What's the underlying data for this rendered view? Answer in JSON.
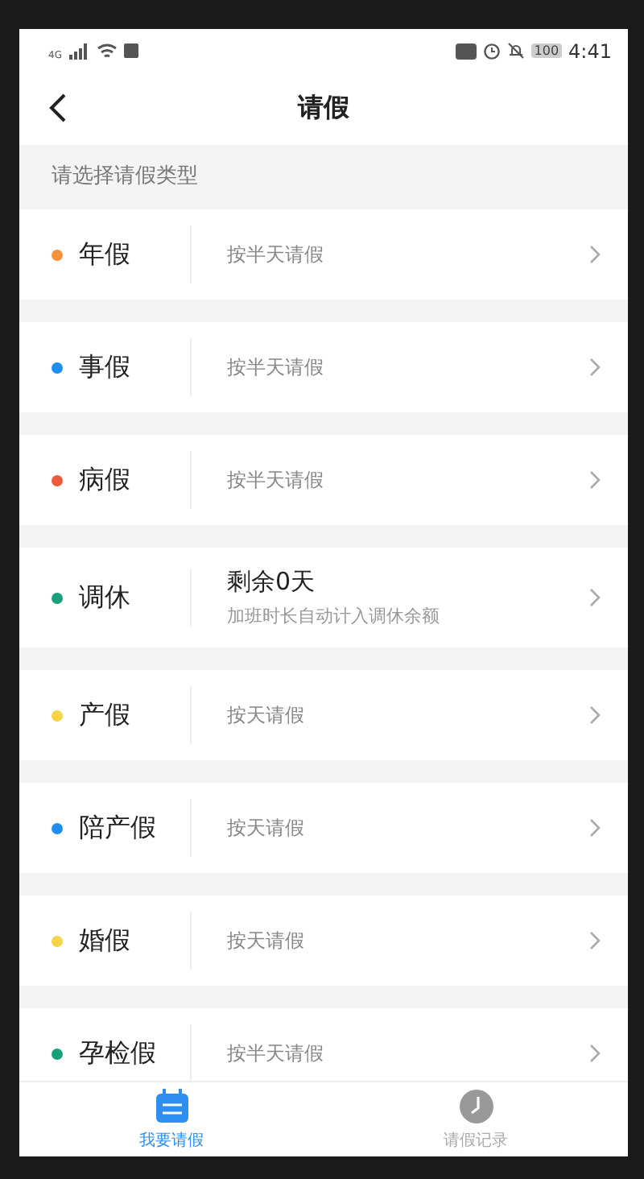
{
  "status_bar": {
    "network": "4G",
    "time": "4:41",
    "battery": "100"
  },
  "nav": {
    "title": "请假"
  },
  "section_header": "请选择请假类型",
  "leave_types": [
    {
      "name": "年假",
      "color": "#f5933a",
      "kind": "simple",
      "note": "按半天请假"
    },
    {
      "name": "事假",
      "color": "#1e8ff0",
      "kind": "simple",
      "note": "按半天请假"
    },
    {
      "name": "病假",
      "color": "#f05a3c",
      "kind": "simple",
      "note": "按半天请假"
    },
    {
      "name": "调休",
      "color": "#17a07a",
      "kind": "balance",
      "balance": "剩余0天",
      "note": "加班时长自动计入调休余额"
    },
    {
      "name": "产假",
      "color": "#f7d348",
      "kind": "simple",
      "note": "按天请假"
    },
    {
      "name": "陪产假",
      "color": "#1e8ff0",
      "kind": "simple",
      "note": "按天请假"
    },
    {
      "name": "婚假",
      "color": "#f7d348",
      "kind": "simple",
      "note": "按天请假"
    },
    {
      "name": "孕检假",
      "color": "#17a07a",
      "kind": "simple",
      "note": "按半天请假"
    }
  ],
  "tabs": [
    {
      "label": "我要请假",
      "selected": true,
      "kind": "apply"
    },
    {
      "label": "请假记录",
      "selected": false,
      "kind": "records"
    }
  ]
}
